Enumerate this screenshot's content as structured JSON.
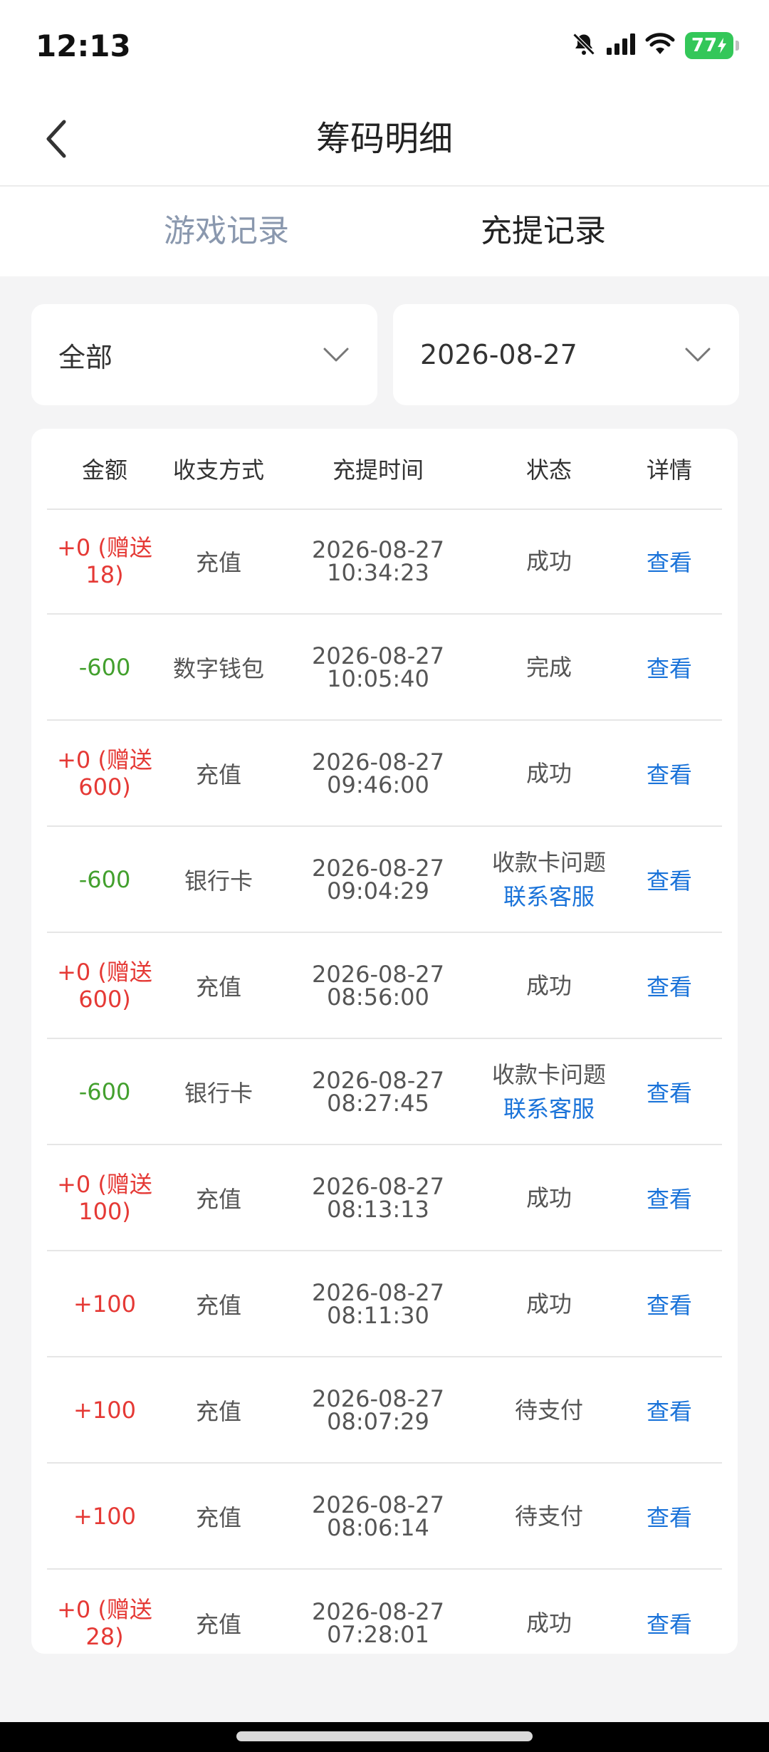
{
  "status_bar": {
    "time": "12:13",
    "battery": "77",
    "icons": [
      "bell-off-icon",
      "signal-icon",
      "wifi-icon",
      "battery-charging-icon"
    ]
  },
  "header": {
    "title": "筹码明细",
    "back_icon": "chevron-left-icon"
  },
  "tabs": [
    {
      "label": "游戏记录",
      "active": false
    },
    {
      "label": "充提记录",
      "active": true
    }
  ],
  "filters": {
    "type": "全部",
    "date": "2026-08-27",
    "dropdown_icon": "chevron-down-icon"
  },
  "table": {
    "columns": [
      "金额",
      "收支方式",
      "充提时间",
      "状态",
      "详情"
    ],
    "rows": [
      {
        "amount": "+0 (赠送18)",
        "amount_color": "#e53935",
        "method": "充值",
        "date": "2026-08-27",
        "time": "10:34:23",
        "status": "成功",
        "contact": "",
        "detail": "查看"
      },
      {
        "amount": "-600",
        "amount_color": "#43a02e",
        "method": "数字钱包",
        "date": "2026-08-27",
        "time": "10:05:40",
        "status": "完成",
        "contact": "",
        "detail": "查看"
      },
      {
        "amount": "+0 (赠送600)",
        "amount_color": "#e53935",
        "method": "充值",
        "date": "2026-08-27",
        "time": "09:46:00",
        "status": "成功",
        "contact": "",
        "detail": "查看"
      },
      {
        "amount": "-600",
        "amount_color": "#43a02e",
        "method": "银行卡",
        "date": "2026-08-27",
        "time": "09:04:29",
        "status": "收款卡问题",
        "contact": "联系客服",
        "detail": "查看"
      },
      {
        "amount": "+0 (赠送600)",
        "amount_color": "#e53935",
        "method": "充值",
        "date": "2026-08-27",
        "time": "08:56:00",
        "status": "成功",
        "contact": "",
        "detail": "查看"
      },
      {
        "amount": "-600",
        "amount_color": "#43a02e",
        "method": "银行卡",
        "date": "2026-08-27",
        "time": "08:27:45",
        "status": "收款卡问题",
        "contact": "联系客服",
        "detail": "查看"
      },
      {
        "amount": "+0 (赠送100)",
        "amount_color": "#e53935",
        "method": "充值",
        "date": "2026-08-27",
        "time": "08:13:13",
        "status": "成功",
        "contact": "",
        "detail": "查看"
      },
      {
        "amount": "+100",
        "amount_color": "#e53935",
        "method": "充值",
        "date": "2026-08-27",
        "time": "08:11:30",
        "status": "成功",
        "contact": "",
        "detail": "查看"
      },
      {
        "amount": "+100",
        "amount_color": "#e53935",
        "method": "充值",
        "date": "2026-08-27",
        "time": "08:07:29",
        "status": "待支付",
        "contact": "",
        "detail": "查看"
      },
      {
        "amount": "+100",
        "amount_color": "#e53935",
        "method": "充值",
        "date": "2026-08-27",
        "time": "08:06:14",
        "status": "待支付",
        "contact": "",
        "detail": "查看"
      },
      {
        "amount": "+0 (赠送28)",
        "amount_color": "#e53935",
        "method": "充值",
        "date": "2026-08-27",
        "time": "07:28:01",
        "status": "成功",
        "contact": "",
        "detail": "查看"
      }
    ]
  }
}
